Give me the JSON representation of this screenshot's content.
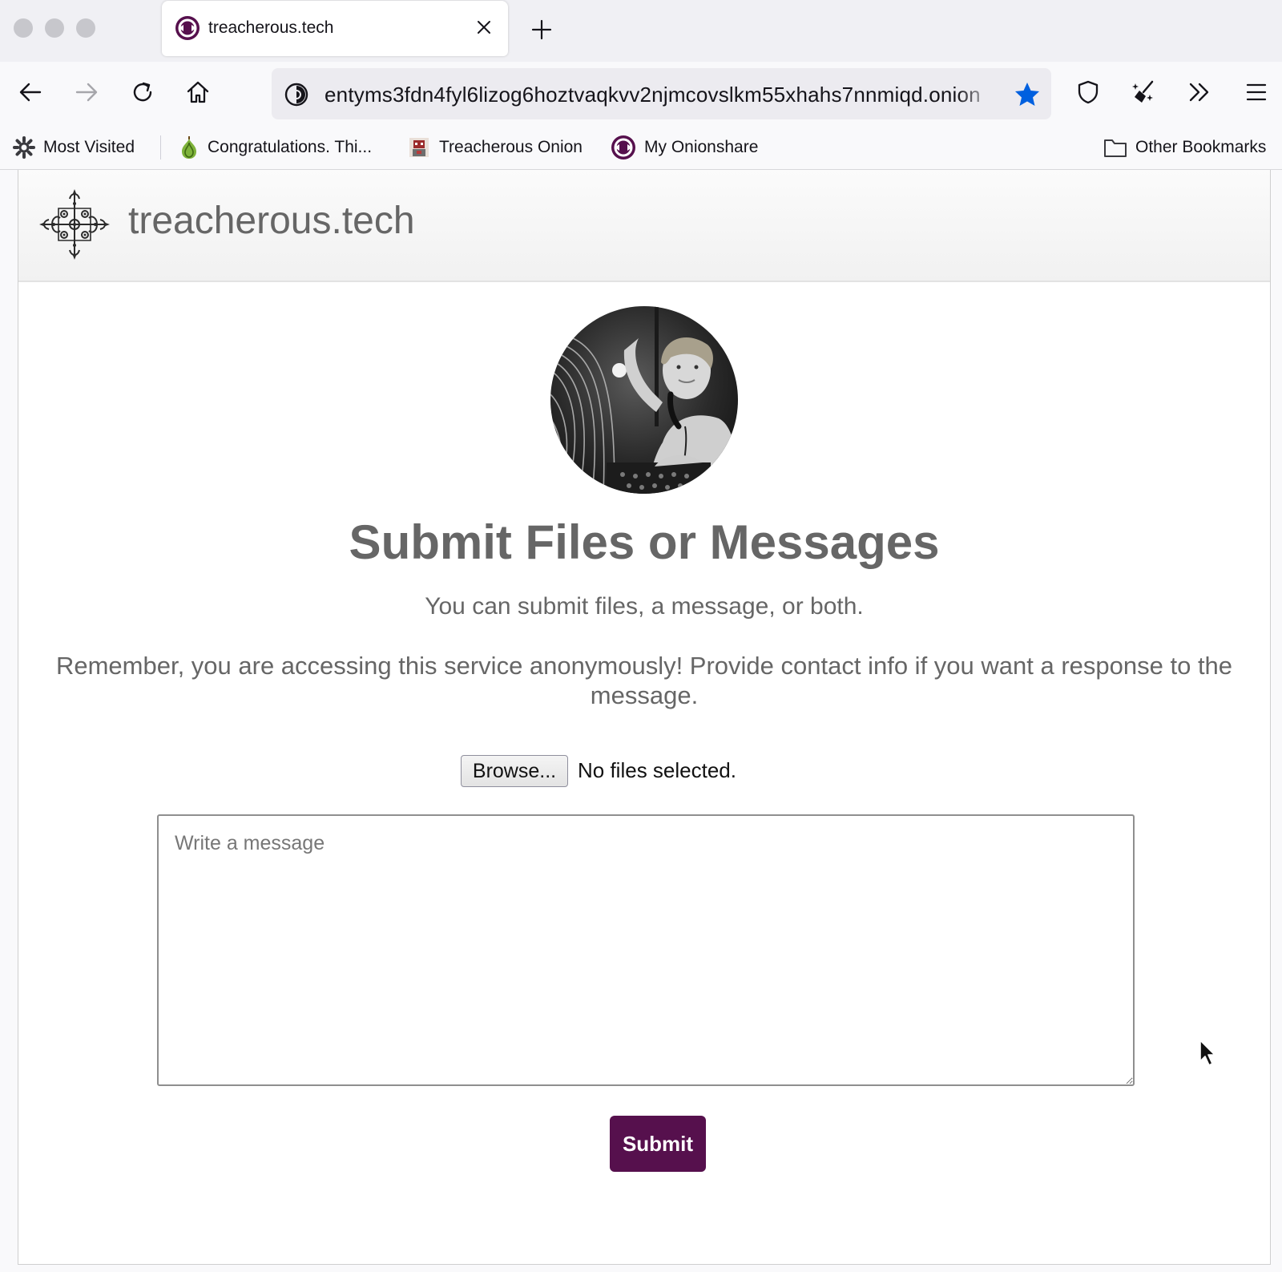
{
  "browser": {
    "tab": {
      "title": "treacherous.tech"
    },
    "url": "entyms3fdn4fyl6lizog6hoztvaqkvv2njmcovslkm55xhahs7nnmiqd.onion",
    "bookmarks": [
      {
        "label": "Most Visited",
        "icon": "gear-icon"
      },
      {
        "label": "Congratulations. Thi...",
        "icon": "onion-icon"
      },
      {
        "label": "Treacherous Onion",
        "icon": "robot-icon"
      },
      {
        "label": "My Onionshare",
        "icon": "onionshare-icon"
      }
    ],
    "other_bookmarks": "Other Bookmarks",
    "accent_color": "#0060df"
  },
  "page": {
    "site_name": "treacherous.tech",
    "heading": "Submit Files or Messages",
    "subtext": "You can submit files, a message, or both.",
    "notice": "Remember, you are accessing this service anonymously! Provide contact info if you want a response to the message.",
    "browse_label": "Browse...",
    "no_files": "No files selected.",
    "message_placeholder": "Write a message",
    "submit_label": "Submit",
    "brand_color": "#56104d"
  }
}
